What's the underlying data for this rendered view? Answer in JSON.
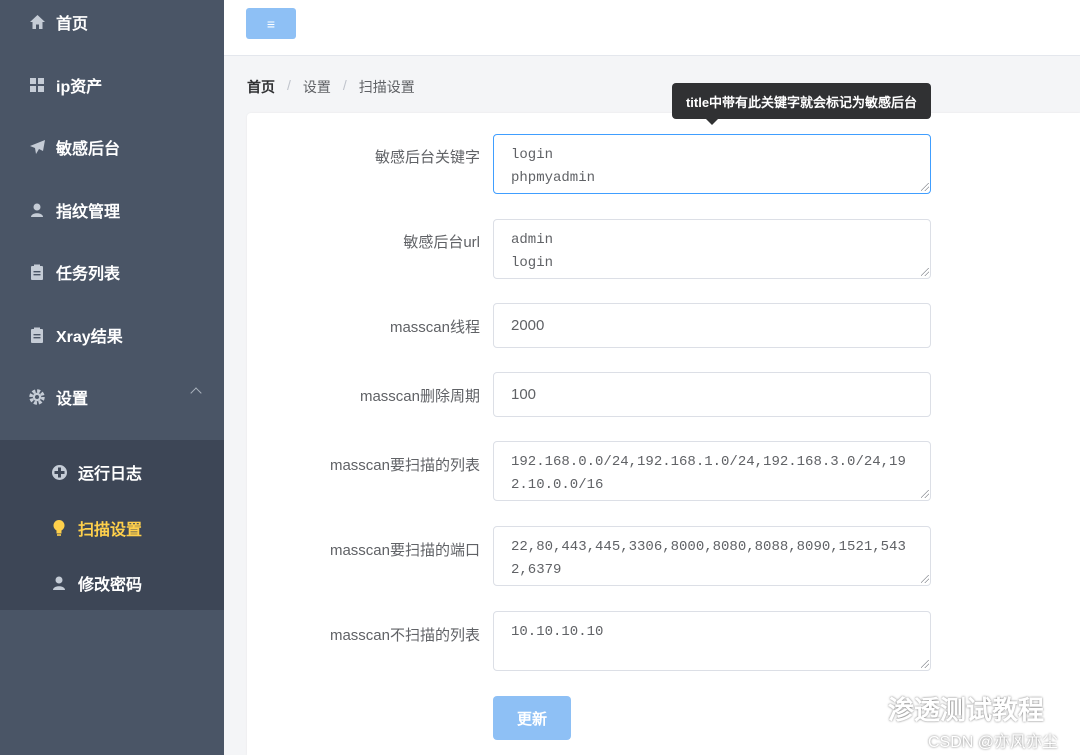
{
  "sidebar": {
    "items": [
      {
        "label": "首页",
        "icon": "home-icon"
      },
      {
        "label": "ip资产",
        "icon": "grid-icon"
      },
      {
        "label": "敏感后台",
        "icon": "paper-plane-icon"
      },
      {
        "label": "指纹管理",
        "icon": "user-icon"
      },
      {
        "label": "任务列表",
        "icon": "clipboard-icon"
      },
      {
        "label": "Xray结果",
        "icon": "clipboard-icon"
      },
      {
        "label": "设置",
        "icon": "gear-icon"
      }
    ],
    "sub_items": [
      {
        "label": "运行日志",
        "icon": "circle-plus-icon"
      },
      {
        "label": "扫描设置",
        "icon": "lightbulb-icon"
      },
      {
        "label": "修改密码",
        "icon": "user-icon"
      }
    ],
    "active_color": "#ffd04b"
  },
  "topbar": {
    "toggle_label": "≡"
  },
  "breadcrumb": [
    "首页",
    "设置",
    "扫描设置"
  ],
  "tooltip": "title中带有此关键字就会标记为敏感后台",
  "form": {
    "fields": [
      {
        "label": "敏感后台关键字",
        "value": "login\nphpmyadmin"
      },
      {
        "label": "敏感后台url",
        "value": "admin\nlogin"
      },
      {
        "label": "masscan线程",
        "value": "2000"
      },
      {
        "label": "masscan删除周期",
        "value": "100"
      },
      {
        "label": "masscan要扫描的列表",
        "value": "192.168.0.0/24,192.168.1.0/24,192.168.3.0/24,192.10.0.0/16"
      },
      {
        "label": "masscan要扫描的端口",
        "value": "22,80,443,445,3306,8000,8080,8088,8090,1521,5432,6379"
      },
      {
        "label": "masscan不扫描的列表",
        "value": "10.10.10.10"
      }
    ],
    "submit_label": "更新"
  },
  "watermark": {
    "line1": "渗透测试教程",
    "line2": "CSDN @亦风亦尘"
  },
  "colors": {
    "sidebar": "#4a5566",
    "primary": "#8ec0f5",
    "focus": "#409eff"
  }
}
